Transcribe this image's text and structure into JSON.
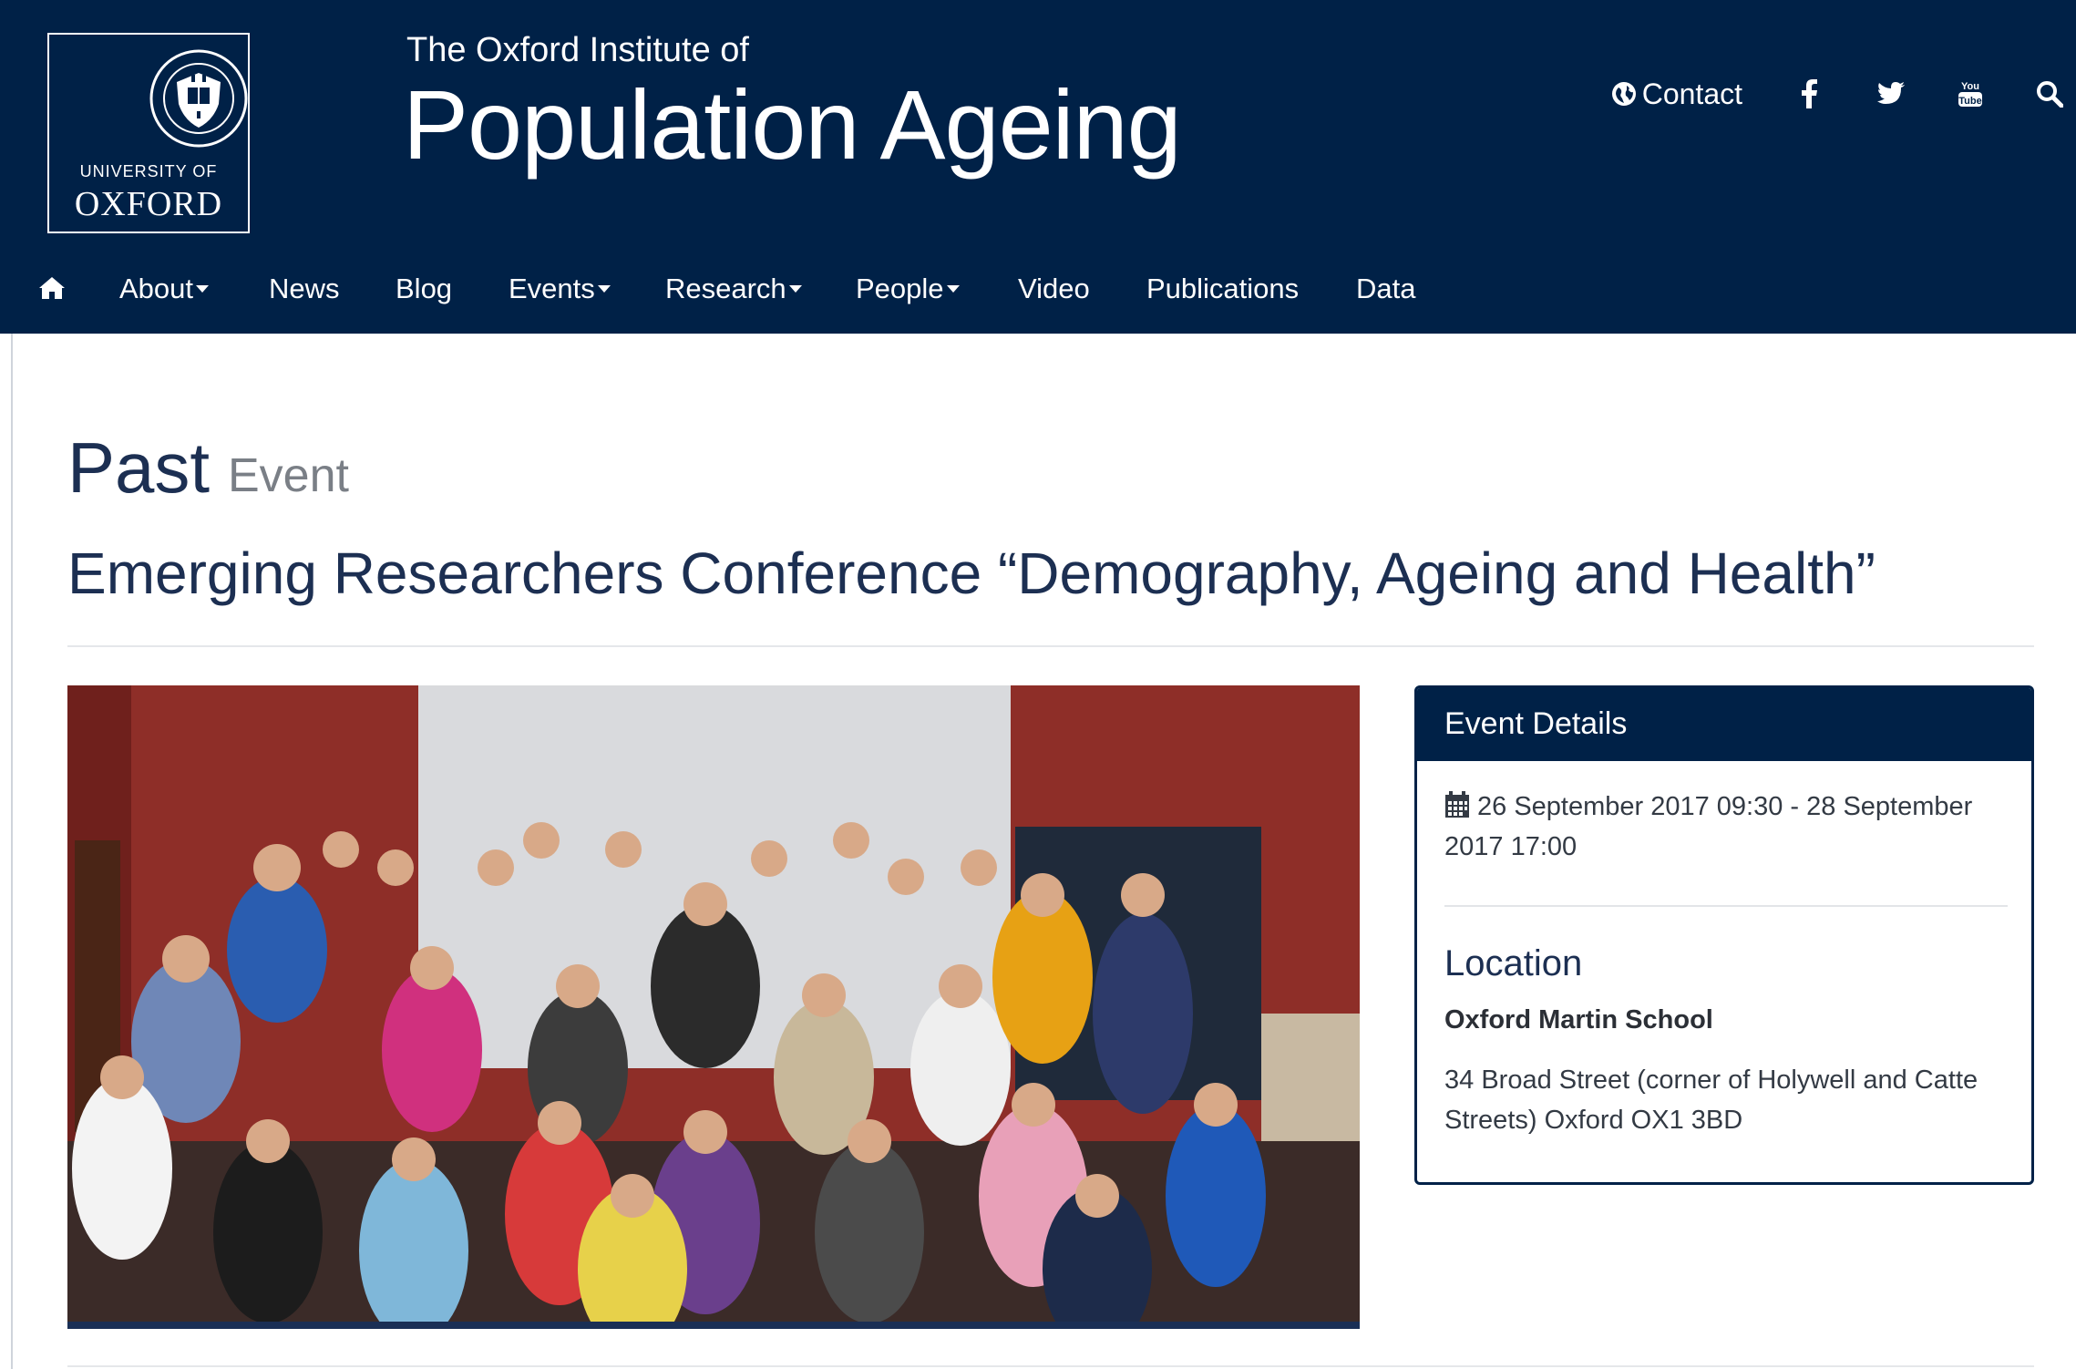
{
  "logo": {
    "university_of": "UNIVERSITY OF",
    "oxford": "OXFORD"
  },
  "site": {
    "subtitle": "The Oxford Institute of",
    "title": "Population Ageing"
  },
  "top_links": {
    "contact": "Contact"
  },
  "nav": {
    "items": [
      "About",
      "News",
      "Blog",
      "Events",
      "Research",
      "People",
      "Video",
      "Publications",
      "Data"
    ]
  },
  "page": {
    "heading_main": "Past",
    "heading_sub": "Event",
    "title": "Emerging Researchers Conference “Demography, Ageing and Health”"
  },
  "event_details": {
    "panel_title": "Event Details",
    "dates": "26 September 2017 09:30 - 28 September 2017 17:00",
    "location_heading": "Location",
    "location_name": "Oxford Martin School",
    "location_address": "34 Broad Street (corner of Holywell and Catte Streets) Oxford OX1 3BD"
  },
  "colors": {
    "brand_navy": "#002147",
    "text_navy": "#1c2f52",
    "muted_grey": "#7a7f86"
  },
  "icons": {
    "home": "home-icon",
    "globe": "globe-icon",
    "facebook": "facebook-icon",
    "twitter": "twitter-icon",
    "youtube": "youtube-icon",
    "search": "search-icon",
    "calendar": "calendar-icon"
  }
}
